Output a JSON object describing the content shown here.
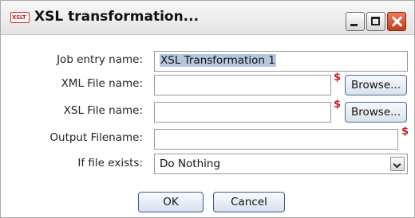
{
  "window": {
    "title": "XSL transformation...",
    "icon_text": "XSLT",
    "icon": "xslt-icon"
  },
  "form": {
    "job_entry_label": "Job entry name:",
    "job_entry_value": "XSL Transformation 1",
    "xml_label": "XML File name:",
    "xml_value": "",
    "xsl_label": "XSL File name:",
    "xsl_value": "",
    "output_label": "Output Filename:",
    "output_value": "",
    "if_exists_label": "If file exists:",
    "if_exists_value": "Do Nothing",
    "variable_marker": "$",
    "browse_label": "Browse..."
  },
  "buttons": {
    "ok": "OK",
    "cancel": "Cancel"
  },
  "colors": {
    "variable_marker": "#c82020",
    "selection": "#b6c6e0",
    "close_button": "#c8381a"
  }
}
